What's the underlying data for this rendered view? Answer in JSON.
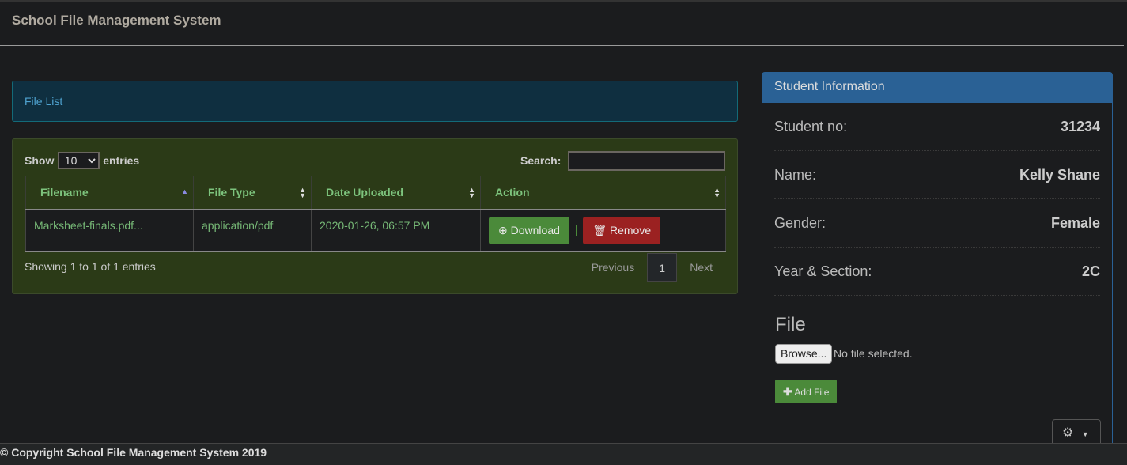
{
  "app": {
    "title": "School File Management System"
  },
  "file_list": {
    "title": "File List"
  },
  "table": {
    "show_label": "Show",
    "entries_label": "entries",
    "page_size": "10",
    "search_label": "Search:",
    "search_value": "",
    "columns": [
      "Filename",
      "File Type",
      "Date Uploaded",
      "Action"
    ],
    "rows": [
      {
        "filename": "Marksheet-finals.pdf...",
        "file_type": "application/pdf",
        "date": "2020-01-26, 06:57 PM",
        "download": "Download",
        "remove": "Remove",
        "separator": "|"
      }
    ],
    "info": "Showing 1 to 1 of 1 entries",
    "pagination": {
      "previous": "Previous",
      "current": "1",
      "next": "Next"
    }
  },
  "student": {
    "title": "Student Information",
    "fields": [
      {
        "label": "Student no:",
        "value": "31234"
      },
      {
        "label": "Name:",
        "value": "Kelly Shane"
      },
      {
        "label": "Gender:",
        "value": "Female"
      },
      {
        "label": "Year & Section:",
        "value": "2C"
      }
    ],
    "file_heading": "File",
    "browse": "Browse...",
    "no_file": "No file selected.",
    "add_file": "Add File"
  },
  "footer": {
    "text": "© Copyright School File Management System 2019"
  }
}
